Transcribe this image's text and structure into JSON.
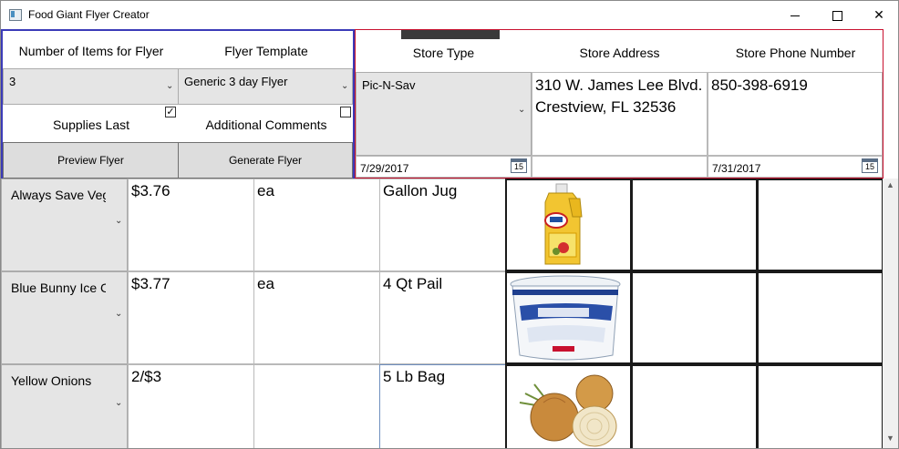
{
  "window": {
    "title": "Food Giant Flyer Creator",
    "min_glyph": "",
    "max_glyph": "",
    "close_glyph": "✕"
  },
  "flyer_settings": {
    "items_label": "Number of Items for Flyer",
    "template_label": "Flyer Template",
    "items_value": "3",
    "template_value": "Generic 3 day Flyer",
    "supplies_last_label": "Supplies Last",
    "supplies_last_checked": true,
    "additional_comments_label": "Additional Comments",
    "additional_comments_checked": false,
    "preview_button": "Preview Flyer",
    "generate_button": "Generate Flyer"
  },
  "store": {
    "type_label": "Store Type",
    "address_label": "Store Address",
    "phone_label": "Store Phone Number",
    "type_value": "Pic-N-Sav",
    "address_line1": "310 W. James Lee Blvd.",
    "address_line2": "Crestview, FL 32536",
    "phone_value": "850-398-6919",
    "start_date": "7/29/2017",
    "end_date": "7/31/2017",
    "calendar_glyph": "15"
  },
  "items": [
    {
      "name": "Always Save Veg",
      "price": "$3.76",
      "unit": "ea",
      "size": "Gallon Jug",
      "image": "vegetable-oil-jug-image"
    },
    {
      "name": "Blue Bunny Ice C",
      "price": "$3.77",
      "unit": "ea",
      "size": "4 Qt Pail",
      "image": "ice-cream-pail-image"
    },
    {
      "name": "Yellow Onions",
      "price": "2/$3",
      "unit": "",
      "size": "5 Lb Bag",
      "image": "onions-image"
    }
  ],
  "colors": {
    "settings_border": "#3b3bb8",
    "store_border": "#c8102e",
    "button_face": "#dddddd",
    "combo_face": "#e5e5e5"
  },
  "icons": {
    "dropdown": "chevron-down-icon",
    "calendar": "calendar-icon",
    "checkbox_mark": "✓"
  }
}
